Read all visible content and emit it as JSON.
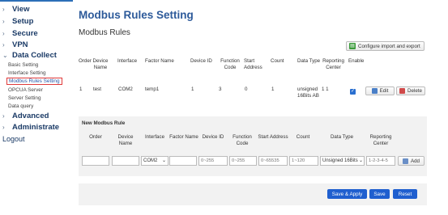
{
  "sidebar": {
    "items": [
      {
        "label": "View",
        "expanded": false
      },
      {
        "label": "Setup",
        "expanded": false
      },
      {
        "label": "Secure",
        "expanded": false
      },
      {
        "label": "VPN",
        "expanded": false
      },
      {
        "label": "Data Collect",
        "expanded": true
      },
      {
        "label": "Advanced",
        "expanded": false
      },
      {
        "label": "Administrate",
        "expanded": false
      }
    ],
    "submenu": [
      "Basic Setting",
      "Interface Setting",
      "Modbus Rules Setting",
      "OPCUA Server",
      "Server Setting",
      "Data query"
    ],
    "active_sub": "Modbus Rules Setting",
    "logout": "Logout"
  },
  "page": {
    "title": "Modbus Rules Setting",
    "section": "Modbus Rules",
    "config_button": "Configure import and export"
  },
  "rules_table": {
    "headers": [
      "Order",
      "Device Name",
      "Interface",
      "Factor Name",
      "Device ID",
      "Function Code",
      "Start Address",
      "Count",
      "Data Type",
      "Reporting Center",
      "Enable"
    ],
    "rows": [
      {
        "order": "1",
        "device_name": "test",
        "interface": "COM2",
        "factor_name": "temp1",
        "device_id": "1",
        "function_code": "3",
        "start_address": "0",
        "count": "1",
        "data_type": "unsigned 16Bits AB",
        "reporting_center": "1 1",
        "enabled": true,
        "edit_label": "Edit",
        "delete_label": "Delete"
      }
    ]
  },
  "new_rule": {
    "title": "New Modbus Rule",
    "headers": [
      "Order",
      "Device Name",
      "Interface",
      "Factor Name",
      "Device ID",
      "Function Code",
      "Start Address",
      "Count",
      "Data Type",
      "Reporting Center"
    ],
    "interface_value": "COM2",
    "device_id_placeholder": "0~255",
    "function_code_placeholder": "0~255",
    "start_address_placeholder": "0~65535",
    "count_placeholder": "1~120",
    "data_type_value": "Unsigned 16Bits",
    "reporting_center_placeholder": "1-2-3-4-5",
    "add_label": "Add"
  },
  "actions": {
    "save_apply": "Save & Apply",
    "save": "Save",
    "reset": "Reset"
  },
  "colors": {
    "accent": "#1f5fcf",
    "title": "#2d5a9a",
    "active_border": "#e03a3a"
  }
}
